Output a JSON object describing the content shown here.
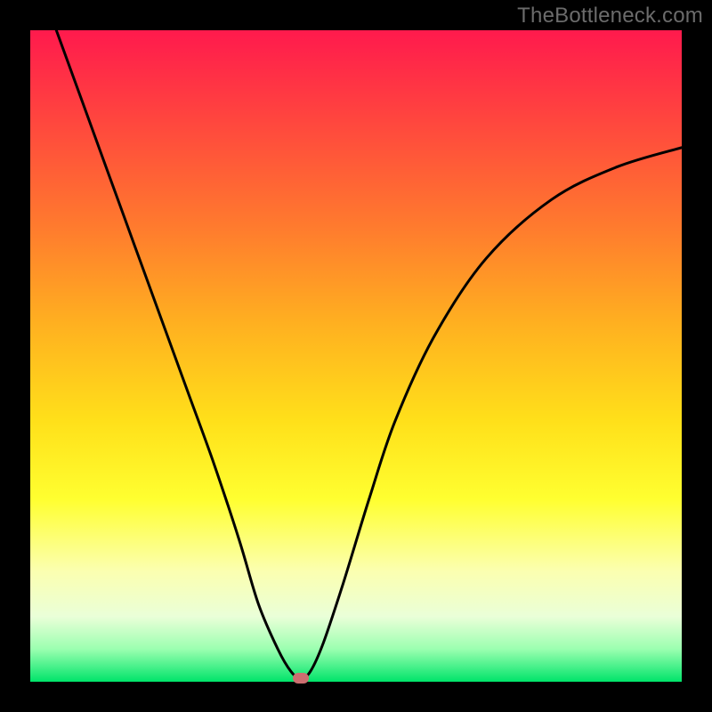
{
  "watermark": "TheBottleneck.com",
  "colors": {
    "frame": "#000000",
    "curve": "#000000",
    "marker": "#cc6e70"
  },
  "chart_data": {
    "type": "line",
    "title": "",
    "xlabel": "",
    "ylabel": "",
    "xlim": [
      0,
      100
    ],
    "ylim": [
      0,
      100
    ],
    "grid": false,
    "legend": false,
    "series": [
      {
        "name": "curve",
        "x": [
          4,
          8,
          12,
          16,
          20,
          24,
          28,
          32,
          35,
          38,
          40,
          41.5,
          43,
          45,
          48,
          52,
          56,
          62,
          70,
          80,
          90,
          100
        ],
        "y": [
          100,
          89,
          78,
          67,
          56,
          45,
          34,
          22,
          12,
          5,
          1.6,
          0.5,
          1.6,
          6,
          15,
          28,
          40,
          53,
          65,
          74,
          79,
          82
        ]
      }
    ],
    "marker": {
      "x": 41.5,
      "y": 0.5
    },
    "background_gradient": [
      {
        "pos": 0,
        "color": "#ff1a4d"
      },
      {
        "pos": 12,
        "color": "#ff4040"
      },
      {
        "pos": 30,
        "color": "#ff7a2e"
      },
      {
        "pos": 45,
        "color": "#ffb020"
      },
      {
        "pos": 60,
        "color": "#ffe01a"
      },
      {
        "pos": 72,
        "color": "#ffff30"
      },
      {
        "pos": 83,
        "color": "#fbffb0"
      },
      {
        "pos": 90,
        "color": "#eaffd8"
      },
      {
        "pos": 95,
        "color": "#9bffb0"
      },
      {
        "pos": 100,
        "color": "#00e46a"
      }
    ]
  }
}
